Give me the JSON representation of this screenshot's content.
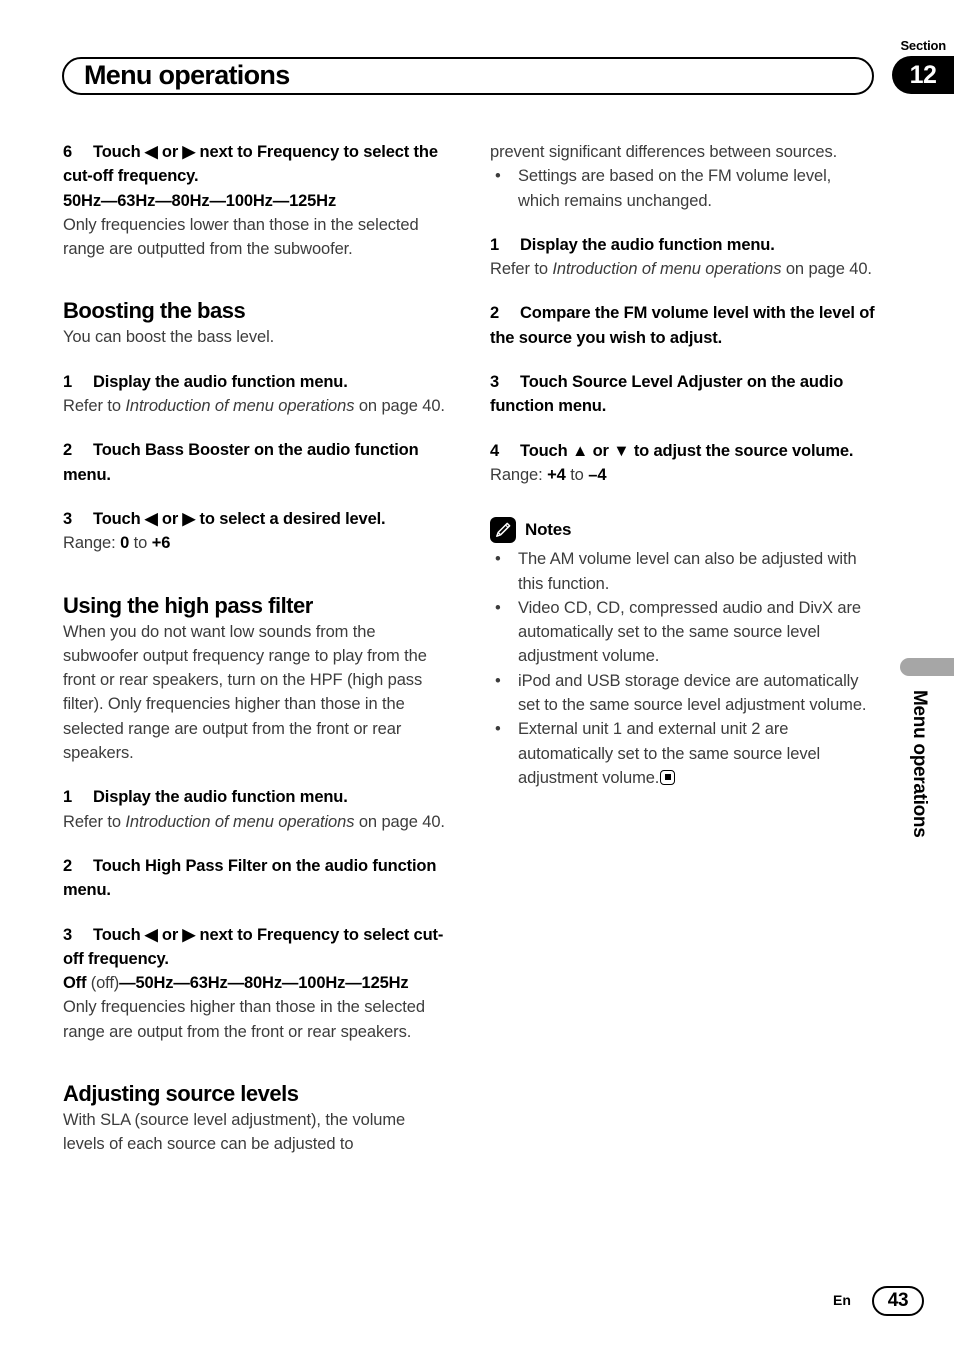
{
  "header": {
    "section_label": "Section",
    "section_number": "12",
    "title": "Menu operations"
  },
  "side_tab": {
    "label": "Menu operations"
  },
  "footer": {
    "language": "En",
    "page_number": "43"
  },
  "left_column": {
    "step6": {
      "num": "6",
      "text": "Touch ◀ or ▶ next to Frequency to select the cut-off frequency.",
      "values": "50Hz—63Hz—80Hz—100Hz—125Hz",
      "body": "Only frequencies lower than those in the selected range are outputted from the subwoofer."
    },
    "boosting": {
      "heading": "Boosting the bass",
      "intro": "You can boost the bass level.",
      "step1": {
        "num": "1",
        "text": "Display the audio function menu.",
        "refer_prefix": "Refer to ",
        "refer_italic": "Introduction of menu operations",
        "refer_suffix": " on page 40."
      },
      "step2": {
        "num": "2",
        "text": "Touch Bass Booster on the audio function menu."
      },
      "step3": {
        "num": "3",
        "text": "Touch ◀ or ▶ to select a desired level.",
        "range_label": "Range: ",
        "range_from": "0",
        "range_to_word": " to ",
        "range_to": "+6"
      }
    },
    "hpf": {
      "heading": "Using the high pass filter",
      "intro": "When you do not want low sounds from the subwoofer output frequency range to play from the front or rear speakers, turn on the HPF (high pass filter). Only frequencies higher than those in the selected range are output from the front or rear speakers.",
      "step1": {
        "num": "1",
        "text": "Display the audio function menu.",
        "refer_prefix": "Refer to ",
        "refer_italic": "Introduction of menu operations",
        "refer_suffix": " on page 40."
      },
      "step2": {
        "num": "2",
        "text": "Touch High Pass Filter on the audio function menu."
      },
      "step3": {
        "num": "3",
        "text": "Touch ◀ or ▶ next to Frequency to select cut-off frequency.",
        "values_off": "Off",
        "values_off_plain": " (off)",
        "values_rest": "—50Hz—63Hz—80Hz—100Hz—125Hz",
        "body": "Only frequencies higher than those in the selected range are output from the front or rear speakers."
      }
    },
    "sla": {
      "heading": "Adjusting source levels",
      "intro": "With SLA (source level adjustment), the volume levels of each source can be adjusted to"
    }
  },
  "right_column": {
    "continued": "prevent significant differences between sources.",
    "bullet_top": "Settings are based on the FM volume level, which remains unchanged.",
    "step1": {
      "num": "1",
      "text": "Display the audio function menu.",
      "refer_prefix": "Refer to ",
      "refer_italic": "Introduction of menu operations",
      "refer_suffix": " on page 40."
    },
    "step2": {
      "num": "2",
      "text": "Compare the FM volume level with the level of the source you wish to adjust."
    },
    "step3": {
      "num": "3",
      "text": "Touch Source Level Adjuster on the audio function menu."
    },
    "step4": {
      "num": "4",
      "text": "Touch ▲ or ▼ to adjust the source volume.",
      "range_label": "Range: ",
      "range_from": "+4",
      "range_to_word": " to ",
      "range_to": "–4"
    },
    "notes": {
      "label": "Notes",
      "icon": "pencil-icon",
      "items": [
        "The AM volume level can also be adjusted with this function.",
        "Video CD, CD, compressed audio and DivX are automatically set to the same source level adjustment volume.",
        "iPod and USB storage device are automatically set to the same source level adjustment volume.",
        "External unit 1 and external unit 2 are automatically set to the same source level adjustment volume."
      ],
      "bullet_glyph": "•"
    }
  }
}
